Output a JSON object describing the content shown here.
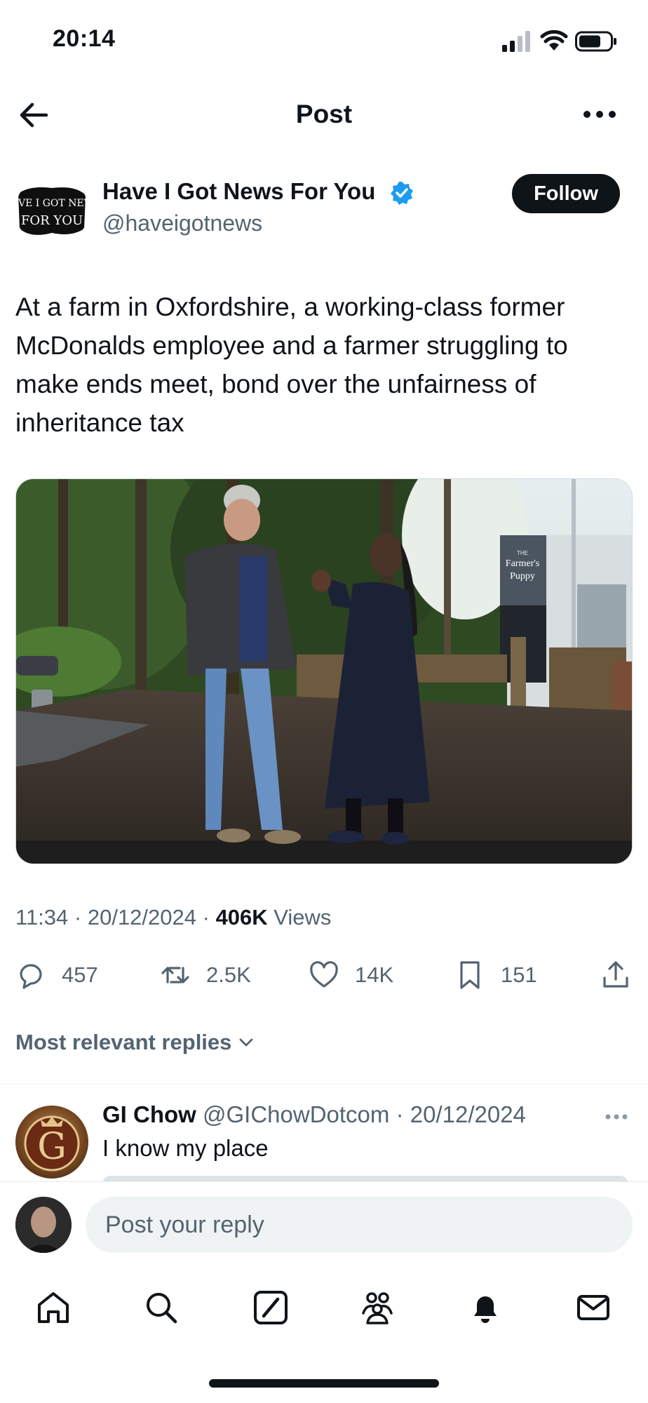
{
  "status_bar": {
    "time": "20:14"
  },
  "header": {
    "title": "Post"
  },
  "post": {
    "author_name": "Have I Got News For You",
    "author_handle": "@haveigotnews",
    "avatar_text_line1": "HAVE I GOT NEWS",
    "avatar_text_line2": "FOR YOU",
    "follow_label": "Follow",
    "text": "At a farm in Oxfordshire, a working-class former McDonalds employee and a farmer struggling to make ends meet, bond over the unfairness of inheritance tax",
    "image_sign_line1": "THE",
    "image_sign_line2": "Farmer's",
    "image_sign_line3": "Puppy",
    "time": "11:34",
    "date": "20/12/2024",
    "views_count": "406K",
    "views_label": "Views",
    "replies_count": "457",
    "reposts_count": "2.5K",
    "likes_count": "14K",
    "bookmarks_count": "151"
  },
  "replies_section": {
    "sort_label": "Most relevant replies"
  },
  "reply": {
    "name": "GI Chow",
    "handle": "@GIChowDotcom",
    "date": "20/12/2024",
    "text": "I know my place",
    "avatar_letter": "G"
  },
  "composer": {
    "placeholder": "Post your reply"
  },
  "colors": {
    "accent": "#1d9bf0",
    "text": "#0f1419",
    "secondary": "#536471"
  }
}
